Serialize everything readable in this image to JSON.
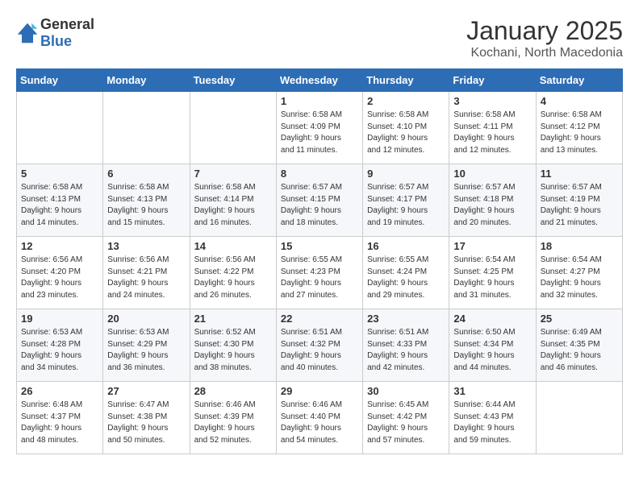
{
  "header": {
    "logo_line1": "General",
    "logo_line2": "Blue",
    "month": "January 2025",
    "location": "Kochani, North Macedonia"
  },
  "weekdays": [
    "Sunday",
    "Monday",
    "Tuesday",
    "Wednesday",
    "Thursday",
    "Friday",
    "Saturday"
  ],
  "weeks": [
    [
      {
        "day": "",
        "info": ""
      },
      {
        "day": "",
        "info": ""
      },
      {
        "day": "",
        "info": ""
      },
      {
        "day": "1",
        "info": "Sunrise: 6:58 AM\nSunset: 4:09 PM\nDaylight: 9 hours\nand 11 minutes."
      },
      {
        "day": "2",
        "info": "Sunrise: 6:58 AM\nSunset: 4:10 PM\nDaylight: 9 hours\nand 12 minutes."
      },
      {
        "day": "3",
        "info": "Sunrise: 6:58 AM\nSunset: 4:11 PM\nDaylight: 9 hours\nand 12 minutes."
      },
      {
        "day": "4",
        "info": "Sunrise: 6:58 AM\nSunset: 4:12 PM\nDaylight: 9 hours\nand 13 minutes."
      }
    ],
    [
      {
        "day": "5",
        "info": "Sunrise: 6:58 AM\nSunset: 4:13 PM\nDaylight: 9 hours\nand 14 minutes."
      },
      {
        "day": "6",
        "info": "Sunrise: 6:58 AM\nSunset: 4:13 PM\nDaylight: 9 hours\nand 15 minutes."
      },
      {
        "day": "7",
        "info": "Sunrise: 6:58 AM\nSunset: 4:14 PM\nDaylight: 9 hours\nand 16 minutes."
      },
      {
        "day": "8",
        "info": "Sunrise: 6:57 AM\nSunset: 4:15 PM\nDaylight: 9 hours\nand 18 minutes."
      },
      {
        "day": "9",
        "info": "Sunrise: 6:57 AM\nSunset: 4:17 PM\nDaylight: 9 hours\nand 19 minutes."
      },
      {
        "day": "10",
        "info": "Sunrise: 6:57 AM\nSunset: 4:18 PM\nDaylight: 9 hours\nand 20 minutes."
      },
      {
        "day": "11",
        "info": "Sunrise: 6:57 AM\nSunset: 4:19 PM\nDaylight: 9 hours\nand 21 minutes."
      }
    ],
    [
      {
        "day": "12",
        "info": "Sunrise: 6:56 AM\nSunset: 4:20 PM\nDaylight: 9 hours\nand 23 minutes."
      },
      {
        "day": "13",
        "info": "Sunrise: 6:56 AM\nSunset: 4:21 PM\nDaylight: 9 hours\nand 24 minutes."
      },
      {
        "day": "14",
        "info": "Sunrise: 6:56 AM\nSunset: 4:22 PM\nDaylight: 9 hours\nand 26 minutes."
      },
      {
        "day": "15",
        "info": "Sunrise: 6:55 AM\nSunset: 4:23 PM\nDaylight: 9 hours\nand 27 minutes."
      },
      {
        "day": "16",
        "info": "Sunrise: 6:55 AM\nSunset: 4:24 PM\nDaylight: 9 hours\nand 29 minutes."
      },
      {
        "day": "17",
        "info": "Sunrise: 6:54 AM\nSunset: 4:25 PM\nDaylight: 9 hours\nand 31 minutes."
      },
      {
        "day": "18",
        "info": "Sunrise: 6:54 AM\nSunset: 4:27 PM\nDaylight: 9 hours\nand 32 minutes."
      }
    ],
    [
      {
        "day": "19",
        "info": "Sunrise: 6:53 AM\nSunset: 4:28 PM\nDaylight: 9 hours\nand 34 minutes."
      },
      {
        "day": "20",
        "info": "Sunrise: 6:53 AM\nSunset: 4:29 PM\nDaylight: 9 hours\nand 36 minutes."
      },
      {
        "day": "21",
        "info": "Sunrise: 6:52 AM\nSunset: 4:30 PM\nDaylight: 9 hours\nand 38 minutes."
      },
      {
        "day": "22",
        "info": "Sunrise: 6:51 AM\nSunset: 4:32 PM\nDaylight: 9 hours\nand 40 minutes."
      },
      {
        "day": "23",
        "info": "Sunrise: 6:51 AM\nSunset: 4:33 PM\nDaylight: 9 hours\nand 42 minutes."
      },
      {
        "day": "24",
        "info": "Sunrise: 6:50 AM\nSunset: 4:34 PM\nDaylight: 9 hours\nand 44 minutes."
      },
      {
        "day": "25",
        "info": "Sunrise: 6:49 AM\nSunset: 4:35 PM\nDaylight: 9 hours\nand 46 minutes."
      }
    ],
    [
      {
        "day": "26",
        "info": "Sunrise: 6:48 AM\nSunset: 4:37 PM\nDaylight: 9 hours\nand 48 minutes."
      },
      {
        "day": "27",
        "info": "Sunrise: 6:47 AM\nSunset: 4:38 PM\nDaylight: 9 hours\nand 50 minutes."
      },
      {
        "day": "28",
        "info": "Sunrise: 6:46 AM\nSunset: 4:39 PM\nDaylight: 9 hours\nand 52 minutes."
      },
      {
        "day": "29",
        "info": "Sunrise: 6:46 AM\nSunset: 4:40 PM\nDaylight: 9 hours\nand 54 minutes."
      },
      {
        "day": "30",
        "info": "Sunrise: 6:45 AM\nSunset: 4:42 PM\nDaylight: 9 hours\nand 57 minutes."
      },
      {
        "day": "31",
        "info": "Sunrise: 6:44 AM\nSunset: 4:43 PM\nDaylight: 9 hours\nand 59 minutes."
      },
      {
        "day": "",
        "info": ""
      }
    ]
  ]
}
